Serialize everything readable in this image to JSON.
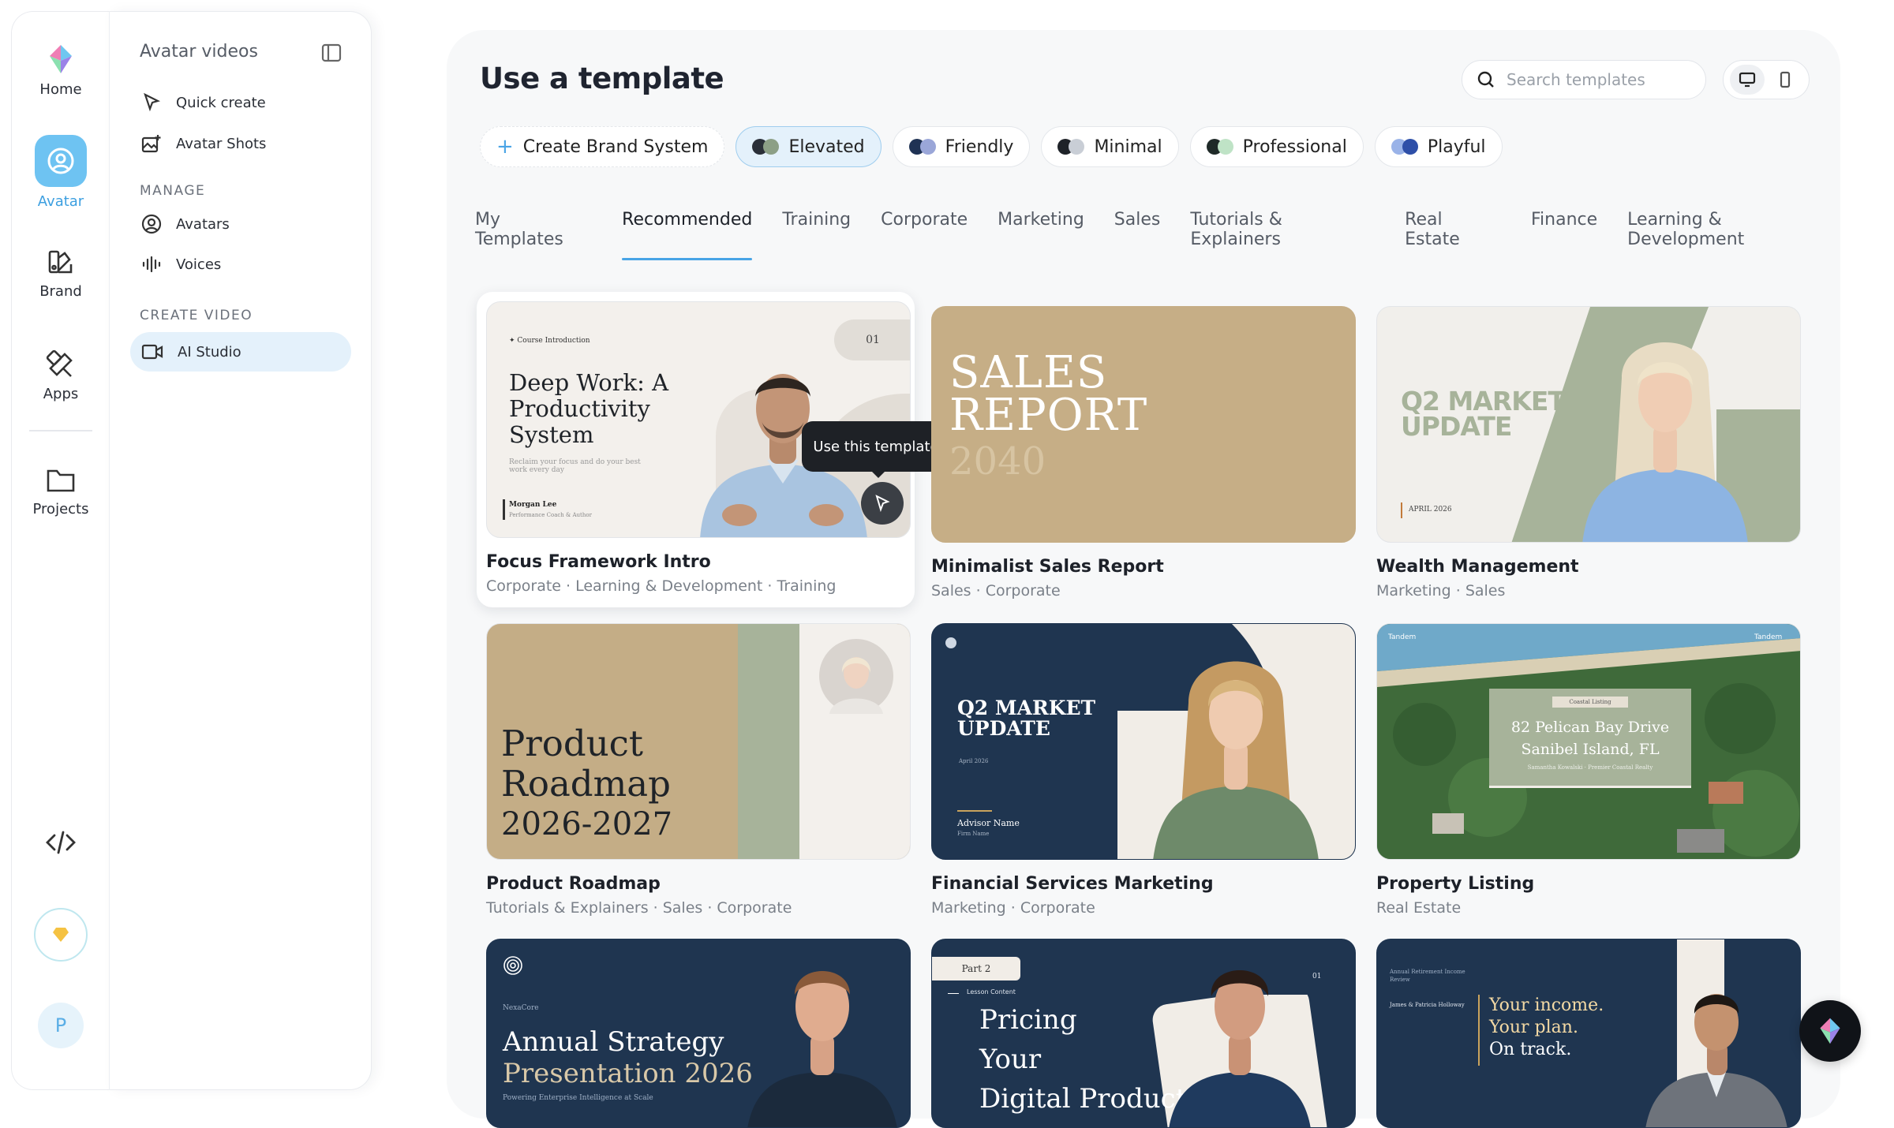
{
  "rail": {
    "items": [
      {
        "label": "Home"
      },
      {
        "label": "Avatar"
      },
      {
        "label": "Brand"
      },
      {
        "label": "Apps"
      },
      {
        "label": "Projects"
      }
    ],
    "profile_initial": "P"
  },
  "panel": {
    "title": "Avatar videos",
    "items": [
      {
        "label": "Quick create",
        "icon": "cursor-click-icon"
      },
      {
        "label": "Avatar Shots",
        "icon": "image-plus-icon"
      }
    ],
    "manage_heading": "MANAGE",
    "manage_items": [
      {
        "label": "Avatars",
        "icon": "user-circle-icon"
      },
      {
        "label": "Voices",
        "icon": "waveform-icon"
      }
    ],
    "create_heading": "CREATE VIDEO",
    "create_items": [
      {
        "label": "AI Studio",
        "icon": "video-camera-icon",
        "active": true
      }
    ]
  },
  "main": {
    "title": "Use a template",
    "search_placeholder": "Search templates",
    "chips": [
      {
        "label": "Create Brand System"
      },
      {
        "label": "Elevated",
        "selected": true,
        "colors": [
          "#2a2f38",
          "#8c9f86"
        ]
      },
      {
        "label": "Friendly",
        "colors": [
          "#1f3254",
          "#9aa6d8"
        ]
      },
      {
        "label": "Minimal",
        "colors": [
          "#1e2228",
          "#c9ced6"
        ]
      },
      {
        "label": "Professional",
        "colors": [
          "#1f2a28",
          "#bfe3c6"
        ]
      },
      {
        "label": "Playful",
        "colors": [
          "#9ab3e8",
          "#2e4fa8"
        ]
      }
    ],
    "tabs": [
      "My Templates",
      "Recommended",
      "Training",
      "Corporate",
      "Marketing",
      "Sales",
      "Tutorials & Explainers",
      "Real Estate",
      "Finance",
      "Learning & Development"
    ],
    "active_tab": "Recommended",
    "tooltip": "Use this template"
  },
  "cards": [
    {
      "title": "Focus Framework Intro",
      "tags": "Corporate · Learning & Development · Training",
      "thumb": {
        "eyebrow": "✦ Course Introduction",
        "heading": "Deep Work: A Productivity System",
        "sub": "Reclaim your focus and do your best work every day",
        "name": "Morgan Lee",
        "role": "Performance Coach & Author",
        "badge": "01"
      }
    },
    {
      "title": "Minimalist Sales Report",
      "tags": "Sales · Corporate",
      "thumb": {
        "line1": "SALES",
        "line2": "REPORT",
        "year": "2040"
      }
    },
    {
      "title": "Wealth Management",
      "tags": "Marketing · Sales",
      "thumb": {
        "line1": "Q2 MARKET",
        "line2": "UPDATE",
        "date": "APRIL 2026"
      }
    },
    {
      "title": "Product Roadmap",
      "tags": "Tutorials & Explainers · Sales · Corporate",
      "thumb": {
        "line1": "Product",
        "line2": "Roadmap",
        "line3": "2026-2027"
      }
    },
    {
      "title": "Financial Services Marketing",
      "tags": "Marketing · Corporate",
      "thumb": {
        "line1": "Q2 MARKET",
        "line2": "UPDATE",
        "date": "April 2026",
        "name": "Advisor Name",
        "role": "Firm Name"
      }
    },
    {
      "title": "Property Listing",
      "tags": "Real Estate",
      "thumb": {
        "brand": "Tandem",
        "badge": "Coastal Listing",
        "line1": "82 Pelican Bay Drive",
        "line2": "Sanibel Island, FL",
        "agent": "Samantha Kowalski · Premier Coastal Realty"
      }
    },
    {
      "title": "",
      "tags": "",
      "thumb": {
        "brand": "NexaCore",
        "line1": "Annual Strategy",
        "line2": "Presentation 2026",
        "sub": "Powering Enterprise Intelligence at Scale"
      }
    },
    {
      "title": "",
      "tags": "",
      "thumb": {
        "part": "Part 2",
        "label": "Lesson Content",
        "badge": "01",
        "line1": "Pricing",
        "line2": "Your",
        "line3": "Digital Product"
      }
    },
    {
      "title": "",
      "tags": "",
      "thumb": {
        "eyebrow": "Annual Retirement Income Review",
        "names": "James & Patricia Holloway",
        "line1": "Your income.",
        "line2": "Your plan.",
        "line3": "On track."
      }
    }
  ],
  "colors": {
    "accent": "#48a4e6",
    "selected_bg": "#e4f1fb",
    "navy": "#1f3550",
    "beige": "#c6ae86",
    "sage": "#a7b39a"
  }
}
